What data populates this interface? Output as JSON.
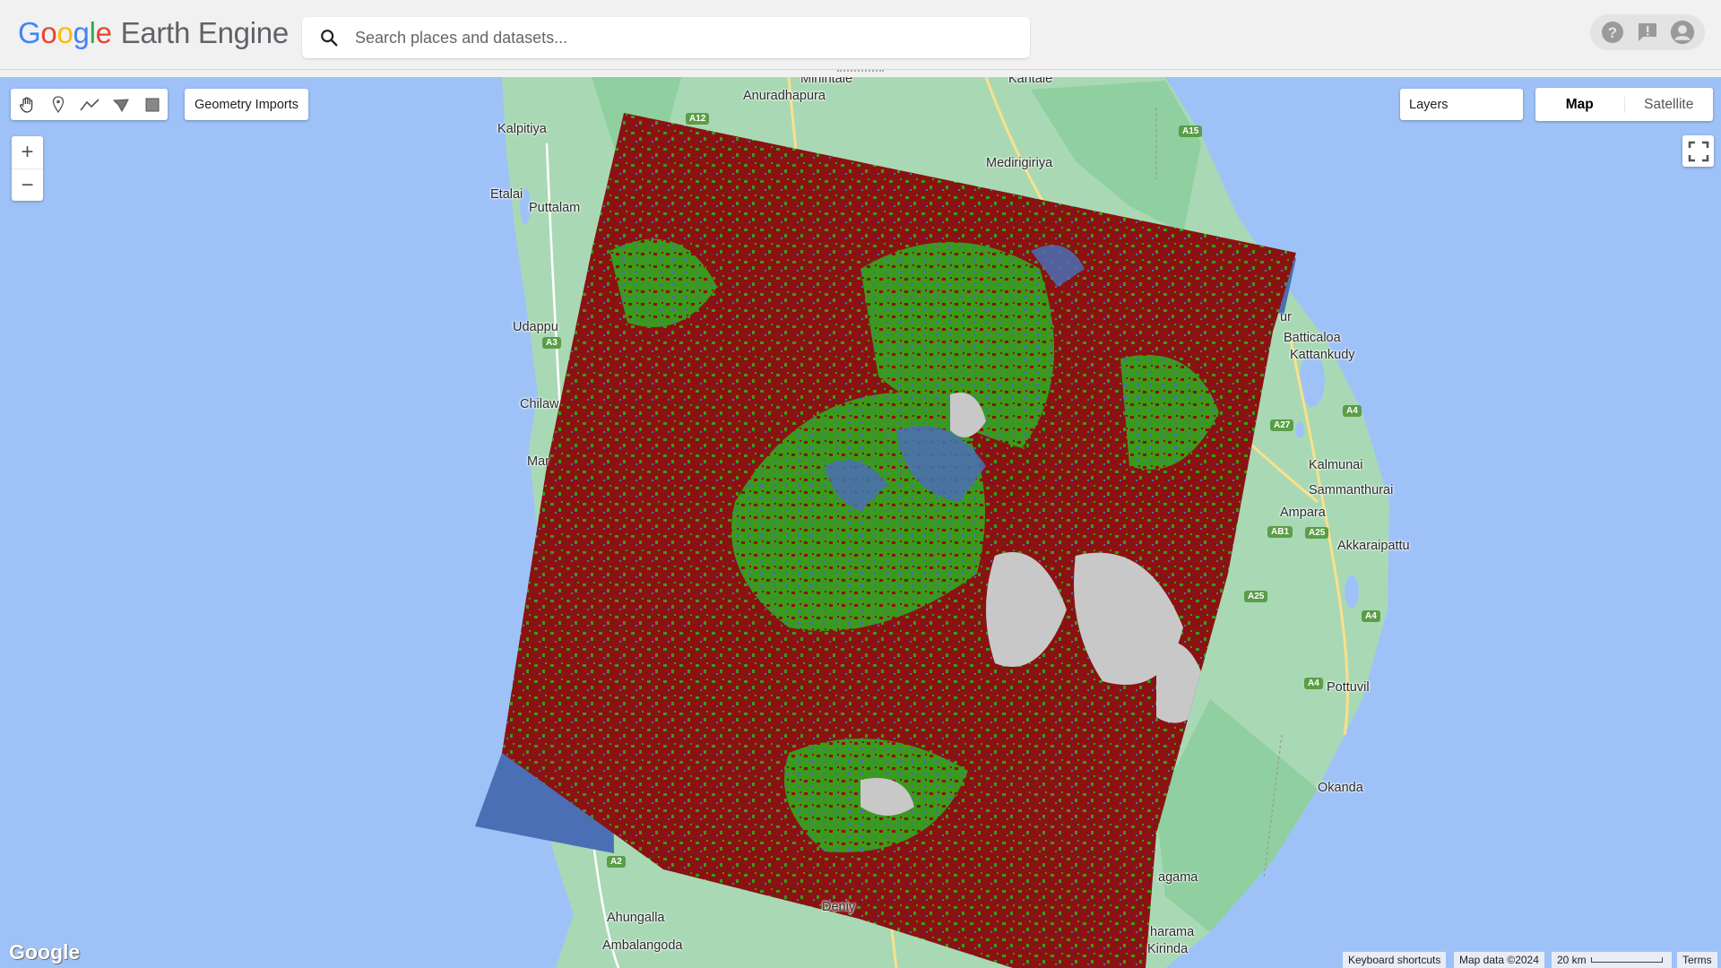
{
  "app": {
    "title_google": "Google",
    "title_product": "Earth Engine"
  },
  "search": {
    "placeholder": "Search places and datasets..."
  },
  "header_icons": [
    "help-icon",
    "feedback-icon",
    "account-icon"
  ],
  "toolbar": {
    "tools": [
      "hand-icon",
      "marker-icon",
      "line-icon",
      "polygon-icon",
      "rectangle-icon"
    ],
    "geometry_imports": "Geometry Imports"
  },
  "layers": {
    "label": "Layers"
  },
  "map_type": {
    "map": "Map",
    "satellite": "Satellite"
  },
  "zoom": {
    "in": "+",
    "out": "−"
  },
  "map_labels": [
    "Mihintale",
    "Kantale",
    "Anuradhapura",
    "Kalpitiya",
    "Medirigiriya",
    "Etalai",
    "Puttalam",
    "Udappu",
    "Chilaw",
    "Mar",
    "Batticaloa",
    "Kattankudy",
    "ur",
    "Kalmunai",
    "Sammanthurai",
    "Ampara",
    "Akkaraipattu",
    "Pottuvil",
    "Okanda",
    "agama",
    "harama",
    "Kirinda",
    "Deniy",
    "Ahungalla",
    "Ambalangoda"
  ],
  "road_shields": [
    "A12",
    "A15",
    "A3",
    "A27",
    "A4",
    "AB1",
    "A25",
    "A25",
    "A4",
    "A4",
    "A2"
  ],
  "footer": {
    "google_logo": "Google",
    "shortcuts": "Keyboard shortcuts",
    "map_data": "Map data ©2024",
    "scale": "20 km",
    "terms": "Terms"
  },
  "colors": {
    "water": "#9ec2f8",
    "land": "#a8d9b4",
    "forest": "#8fcfa0",
    "class_red": "#8b1212",
    "class_green": "#3a9a1c",
    "class_blue": "#4a6fb5",
    "class_gray": "#c8c8c8"
  }
}
